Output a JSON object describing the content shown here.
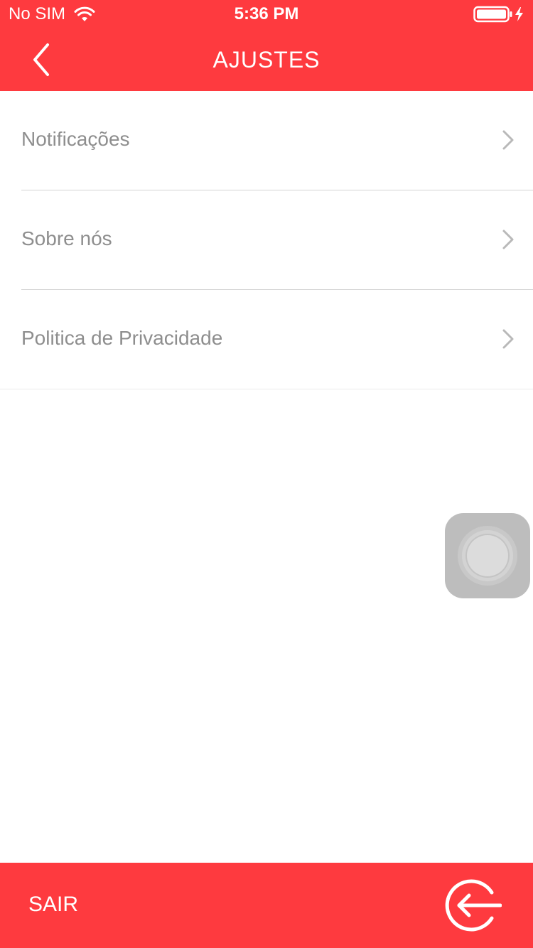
{
  "status_bar": {
    "carrier": "No SIM",
    "time": "5:36 PM",
    "icons": [
      "wifi-icon",
      "battery-icon",
      "charging-bolt-icon"
    ]
  },
  "nav": {
    "title": "AJUSTES",
    "back_icon": "chevron-left-icon"
  },
  "settings": {
    "items": [
      {
        "label": "Notificações",
        "icon": "chevron-right-icon"
      },
      {
        "label": "Sobre nós",
        "icon": "chevron-right-icon"
      },
      {
        "label": "Politica de Privacidade",
        "icon": "chevron-right-icon"
      }
    ]
  },
  "bottom_bar": {
    "label": "SAIR",
    "icon": "logout-icon"
  },
  "colors": {
    "accent": "#fe3a3f",
    "label_text": "#8e8e8e",
    "separator": "#d4d4d4",
    "chevron": "#b9b9b9"
  }
}
